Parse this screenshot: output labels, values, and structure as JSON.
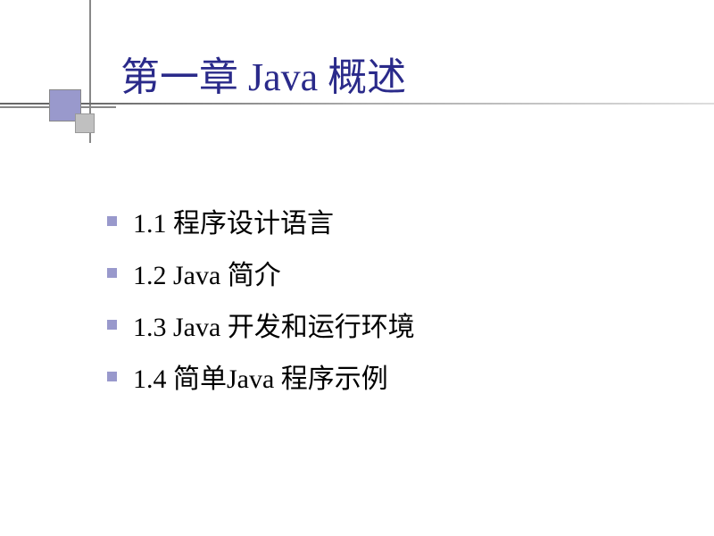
{
  "slide": {
    "title": "第一章 Java 概述",
    "items": [
      "1.1  程序设计语言",
      "1.2  Java 简介",
      "1.3 Java  开发和运行环境",
      "1.4  简单Java 程序示例"
    ]
  }
}
